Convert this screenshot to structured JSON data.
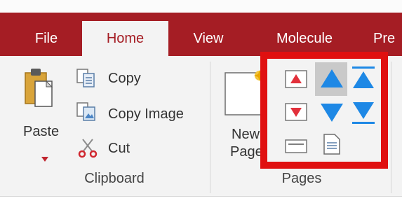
{
  "tabs": [
    {
      "label": "File",
      "active": false
    },
    {
      "label": "Home",
      "active": true
    },
    {
      "label": "View",
      "active": false
    },
    {
      "label": "Molecule",
      "active": false
    },
    {
      "label": "Pre",
      "active": false
    }
  ],
  "clipboard": {
    "paste_label": "Paste",
    "copy_label": "Copy",
    "copy_image_label": "Copy Image",
    "cut_label": "Cut",
    "group_label": "Clipboard"
  },
  "pages": {
    "new_page_line1": "New",
    "new_page_line2": "Page",
    "group_label": "Pages"
  },
  "colors": {
    "accent": "#a51d24",
    "highlight": "#e01010",
    "arrow_blue": "#1e88e5"
  }
}
